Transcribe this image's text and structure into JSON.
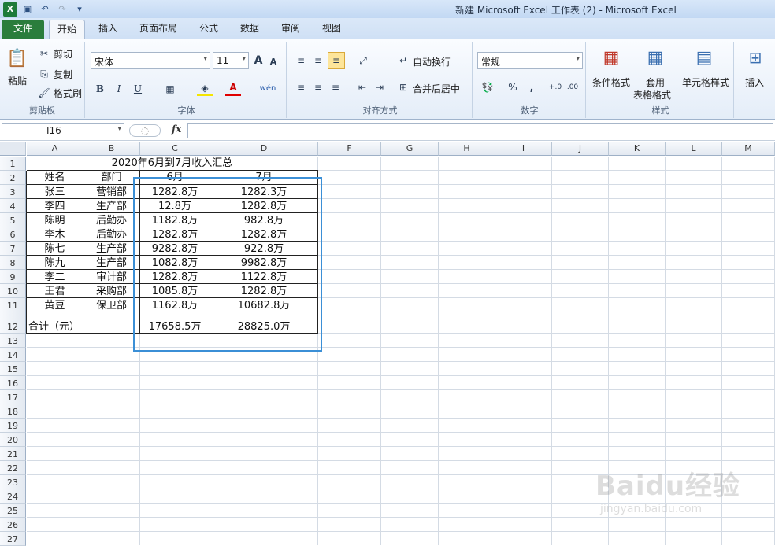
{
  "window": {
    "title": "新建 Microsoft Excel 工作表 (2)  -  Microsoft Excel"
  },
  "quick_access": {
    "app_icon": "X"
  },
  "tabs": [
    "文件",
    "开始",
    "插入",
    "页面布局",
    "公式",
    "数据",
    "审阅",
    "视图"
  ],
  "ribbon": {
    "clipboard": {
      "paste": "粘贴",
      "cut": "剪切",
      "copy": "复制",
      "format_painter": "格式刷",
      "label": "剪贴板"
    },
    "font": {
      "name": "宋体",
      "size": "11",
      "label": "字体",
      "bold": "B",
      "italic": "I",
      "underline": "U",
      "grow": "A",
      "shrink": "A",
      "font_color": "A",
      "wen": "wén"
    },
    "alignment": {
      "wrap": "自动换行",
      "merge": "合并后居中",
      "label": "对齐方式"
    },
    "number": {
      "format": "常规",
      "percent": "%",
      "comma": ",",
      "inc": "+.0",
      "dec": ".00",
      "label": "数字"
    },
    "styles": {
      "cond": "条件格式",
      "table_1": "套用",
      "table_2": "表格格式",
      "cell": "单元格样式",
      "label": "样式"
    },
    "cells": {
      "insert": "插入"
    }
  },
  "formula_bar": {
    "namebox": "I16",
    "fx": "fx",
    "value": ""
  },
  "columns": [
    "A",
    "B",
    "C",
    "D",
    "F",
    "G",
    "H",
    "I",
    "J",
    "K",
    "L",
    "M"
  ],
  "rows": [
    "1",
    "2",
    "3",
    "4",
    "5",
    "6",
    "7",
    "8",
    "9",
    "10",
    "11",
    "12",
    "13",
    "14",
    "15",
    "16",
    "17",
    "18",
    "19",
    "20",
    "21",
    "22",
    "23",
    "24",
    "25",
    "26",
    "27"
  ],
  "sheet": {
    "title": "2020年6月到7月收入汇总",
    "headers": [
      "姓名",
      "部门",
      "6月",
      "7月"
    ],
    "data": [
      [
        "张三",
        "营销部",
        "1282.8万",
        "1282.3万"
      ],
      [
        "李四",
        "生产部",
        "12.8万",
        "1282.8万"
      ],
      [
        "陈明",
        "后勤办",
        "1182.8万",
        "982.8万"
      ],
      [
        "李木",
        "后勤办",
        "1282.8万",
        "1282.8万"
      ],
      [
        "陈七",
        "生产部",
        "9282.8万",
        "922.8万"
      ],
      [
        "陈九",
        "生产部",
        "1082.8万",
        "9982.8万"
      ],
      [
        "李二",
        "审计部",
        "1282.8万",
        "1122.8万"
      ],
      [
        "王君",
        "采购部",
        "1085.8万",
        "1282.8万"
      ],
      [
        "黄豆",
        "保卫部",
        "1162.8万",
        "10682.8万"
      ]
    ],
    "total": [
      "合计（元）",
      "",
      "17658.5万",
      "28825.0万"
    ]
  },
  "watermark": {
    "brand": "Baidu经验",
    "url": "jingyan.baidu.com"
  }
}
